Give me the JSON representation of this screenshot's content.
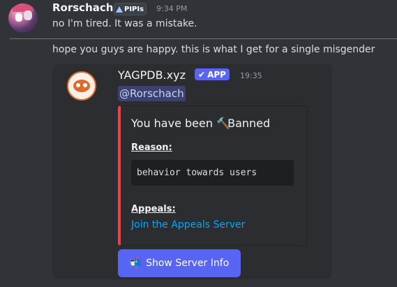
{
  "message1": {
    "username": "Rorschach",
    "badge": "PIPIs",
    "time": "9:34 PM",
    "text": "no I'm tired. It was a mistake."
  },
  "message2": {
    "text": "hope you guys are happy. this is what I get for a single misgender"
  },
  "bot": {
    "name": "YAGPDB.xyz",
    "app_label": "APP",
    "time": "19:35",
    "mention": "@Rorschach"
  },
  "embed": {
    "title": "You have been",
    "title_icon": "hammer-icon",
    "title_suffix": "Banned",
    "reason_label": "Reason:",
    "reason_value": "behavior towards users",
    "appeals_label": "Appeals:",
    "appeals_link": "Join the Appeals Server",
    "accent": "#f23f43"
  },
  "button": {
    "icon": "mailbox-icon",
    "label": "Show Server Info",
    "color": "#5865f2"
  }
}
